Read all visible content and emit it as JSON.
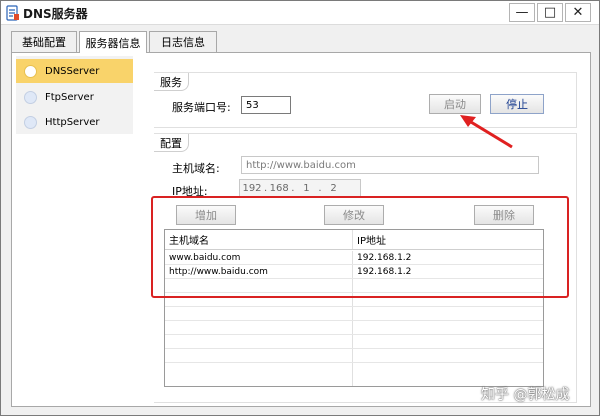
{
  "window": {
    "title": "DNS服务器",
    "controls": {
      "minimize": "—",
      "maximize": "□",
      "close": "✕"
    }
  },
  "tabs": [
    {
      "label": "基础配置",
      "active": false
    },
    {
      "label": "服务器信息",
      "active": true
    },
    {
      "label": "日志信息",
      "active": false
    }
  ],
  "sidebar": {
    "items": [
      {
        "label": "DNSServer",
        "active": true
      },
      {
        "label": "FtpServer",
        "active": false
      },
      {
        "label": "HttpServer",
        "active": false
      }
    ]
  },
  "service": {
    "group_label": "服务",
    "port_label": "服务端口号:",
    "port_value": "53",
    "start_label": "启动",
    "stop_label": "停止"
  },
  "config": {
    "group_label": "配置",
    "hostname_label": "主机域名:",
    "hostname_value": "http://www.baidu.com",
    "ip_label": "IP地址:",
    "ip_octets": [
      "192",
      "168",
      "1",
      "2"
    ],
    "ip_separator": ".",
    "add_label": "增加",
    "edit_label": "修改",
    "delete_label": "删除"
  },
  "table": {
    "columns": [
      "主机域名",
      "IP地址"
    ],
    "rows": [
      [
        "www.baidu.com",
        "192.168.1.2"
      ],
      [
        "http://www.baidu.com",
        "192.168.1.2"
      ]
    ]
  },
  "annotation": {
    "highlight_color": "#d92222"
  },
  "watermark": "知乎 @郭松成",
  "colors": {
    "accent_selected": "#f9d36a",
    "button_blue_text": "#1a3d8f"
  }
}
